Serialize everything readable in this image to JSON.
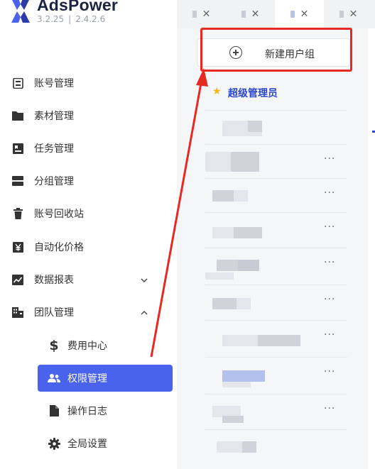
{
  "brand": {
    "name": "AdsPower",
    "version_a": "3.2.25",
    "separator": "|",
    "version_b": "2.4.2.6"
  },
  "sidebar": {
    "items": [
      {
        "label": "账号管理",
        "icon": "account-icon"
      },
      {
        "label": "素材管理",
        "icon": "folder-icon"
      },
      {
        "label": "任务管理",
        "icon": "task-icon"
      },
      {
        "label": "分组管理",
        "icon": "group-icon"
      },
      {
        "label": "账号回收站",
        "icon": "trash-icon"
      },
      {
        "label": "自动化价格",
        "icon": "yen-icon"
      },
      {
        "label": "数据报表",
        "icon": "chart-icon",
        "chevron": "⌄"
      },
      {
        "label": "团队管理",
        "icon": "team-icon",
        "chevron": "⌃"
      }
    ],
    "sub_items": [
      {
        "label": "费用中心",
        "icon": "dollar-icon"
      },
      {
        "label": "权限管理",
        "icon": "users-icon",
        "active": true
      },
      {
        "label": "操作日志",
        "icon": "document-icon"
      },
      {
        "label": "全局设置",
        "icon": "gear-icon"
      }
    ]
  },
  "tabs": [
    {
      "close": "✕"
    },
    {
      "close": "✕"
    },
    {
      "close": "✕",
      "active": true
    },
    {
      "close": "✕"
    }
  ],
  "groups": {
    "new_group_label": "新建用户组",
    "first_group": {
      "name": "超级管理员",
      "star": "★"
    },
    "more_label": "···"
  },
  "colors": {
    "accent": "#4a63ec",
    "annotation": "#e52a24",
    "link": "#2c48c9",
    "star": "#f2b705"
  }
}
